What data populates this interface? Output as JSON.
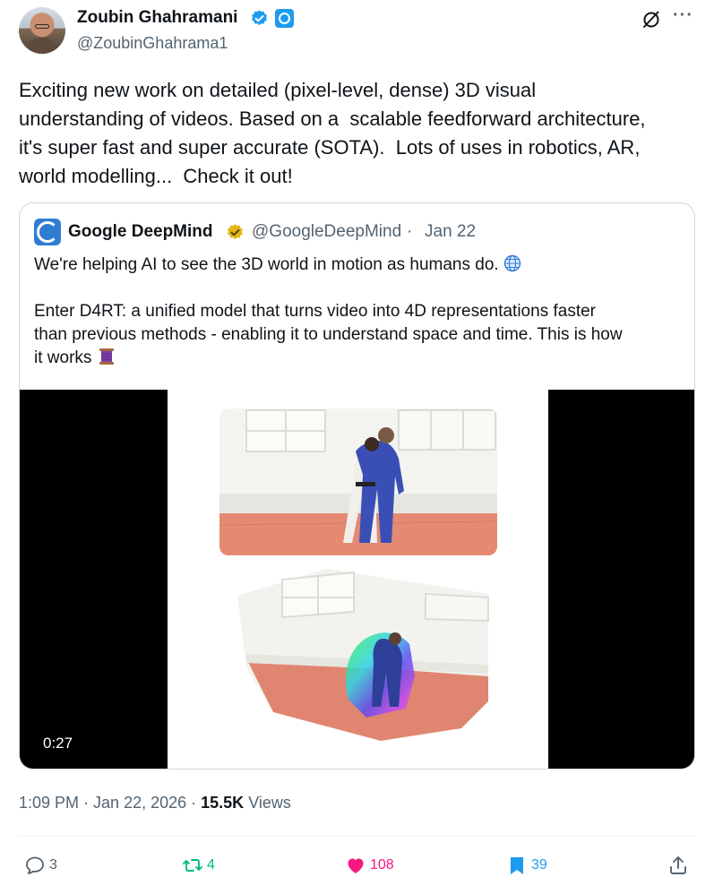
{
  "tweet": {
    "author": {
      "name": "Zoubin Ghahramani",
      "handle": "@ZoubinGhahrama1"
    },
    "text": "Exciting new work on detailed (pixel-level, dense) 3D visual\nunderstanding of videos. Based on a  scalable feedforward architecture,\nit's super fast and super accurate (SOTA).  Lots of uses in robotics, AR,\nworld modelling...  Check it out!",
    "icons": [
      "verified-badge-icon",
      "affiliate-badge-icon",
      "grok-icon",
      "more-icon"
    ]
  },
  "quote": {
    "author": {
      "name": "Google DeepMind",
      "handle": "@GoogleDeepMind",
      "separator": "·",
      "date": "Jan 22"
    },
    "text_line1": "We're helping AI to see the 3D world in motion as humans do. ",
    "text_body": "Enter D4RT: a unified model that turns video into 4D representations faster\nthan previous methods - enabling it to understand space and time. This is how\nit works ",
    "video": {
      "duration": "0:27"
    }
  },
  "meta": {
    "time": "1:09 PM",
    "sep1": " · ",
    "date": "Jan 22, 2026",
    "sep2": " · ",
    "views": "15.5K",
    "views_label": " Views"
  },
  "actions": {
    "reply_count": "3",
    "retweet_count": "4",
    "like_count": "108",
    "bookmark_count": "39"
  },
  "colors": {
    "text": "#0f1419",
    "secondary": "#536471",
    "verified_blue": "#1d9bf0",
    "verified_gold": "#e2b719",
    "retweet_green": "#00ba7c",
    "like_pink": "#f91880",
    "border": "#cfd9de"
  }
}
